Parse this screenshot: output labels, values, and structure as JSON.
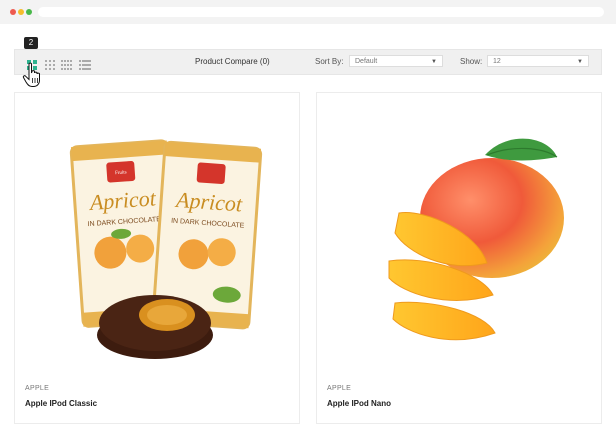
{
  "toolbar": {
    "tooltip_count": "2",
    "compare_label": "Product Compare (0)",
    "sort_label": "Sort By:",
    "sort_value": "Default",
    "show_label": "Show:",
    "show_value": "12"
  },
  "products": [
    {
      "category": "APPLE",
      "name": "Apple IPod Classic",
      "image": "apricot-chocolate-candies"
    },
    {
      "category": "APPLE",
      "name": "Apple IPod Nano",
      "image": "mango-fruit-slices"
    }
  ],
  "colors": {
    "accent": "#2db38f",
    "toolbar_bg": "#f0f0f0"
  }
}
